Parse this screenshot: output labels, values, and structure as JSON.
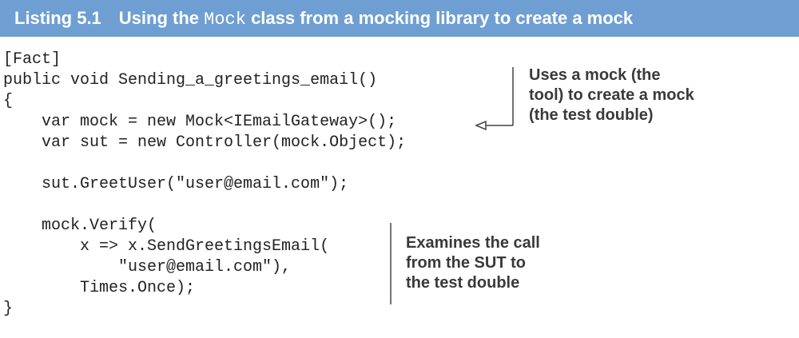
{
  "listing": {
    "number": "Listing 5.1",
    "title_before": "Using the ",
    "title_code": "Mock",
    "title_after": " class from a mocking library to create a mock"
  },
  "code": {
    "lines": [
      "[Fact]",
      "public void Sending_a_greetings_email()",
      "{",
      "    var mock = new Mock<IEmailGateway>();",
      "    var sut = new Controller(mock.Object);",
      "",
      "    sut.GreetUser(\"user@email.com\");",
      "",
      "    mock.Verify(",
      "        x => x.SendGreetingsEmail(",
      "            \"user@email.com\"),",
      "        Times.Once);",
      "}"
    ]
  },
  "annotations": [
    {
      "text": "Uses a mock (the\ntool) to create a mock\n(the test double)"
    },
    {
      "text": "Examines the call\nfrom the SUT to\nthe test double"
    }
  ],
  "colors": {
    "header_background": "#6f9fd2",
    "header_text": "#ffffff",
    "code_text": "#222222",
    "annotation_text": "#3a3a3a"
  }
}
